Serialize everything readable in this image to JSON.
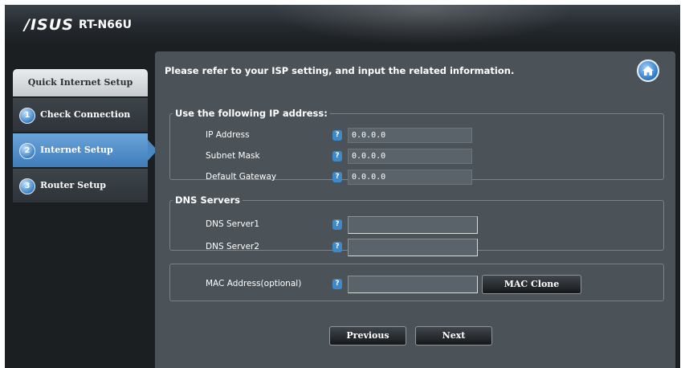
{
  "header": {
    "brand": "/ISUS",
    "model": "RT-N66U"
  },
  "sidebar": {
    "title": "Quick Internet Setup",
    "items": [
      {
        "number": "1",
        "label": "Check Connection",
        "active": false
      },
      {
        "number": "2",
        "label": "Internet Setup",
        "active": true
      },
      {
        "number": "3",
        "label": "Router Setup",
        "active": false
      }
    ]
  },
  "main": {
    "instruction": "Please refer to your ISP setting, and input the related information.",
    "help_glyph": "?",
    "ip_section": {
      "legend": "Use the following IP address:",
      "fields": [
        {
          "label": "IP Address",
          "value": "0.0.0.0"
        },
        {
          "label": "Subnet Mask",
          "value": "0.0.0.0"
        },
        {
          "label": "Default Gateway",
          "value": "0.0.0.0"
        }
      ]
    },
    "dns_section": {
      "legend": "DNS Servers",
      "fields": [
        {
          "label": "DNS Server1",
          "value": ""
        },
        {
          "label": "DNS Server2",
          "value": ""
        }
      ]
    },
    "mac_section": {
      "label": "MAC Address(optional)",
      "value": "",
      "clone_button": "MAC Clone"
    },
    "buttons": {
      "previous": "Previous",
      "next": "Next"
    }
  },
  "icons": {
    "home": "home-icon"
  },
  "colors": {
    "accent_blue": "#3f7cb8",
    "panel_bg": "#4b5359",
    "frame_bg": "#1b1f22"
  }
}
